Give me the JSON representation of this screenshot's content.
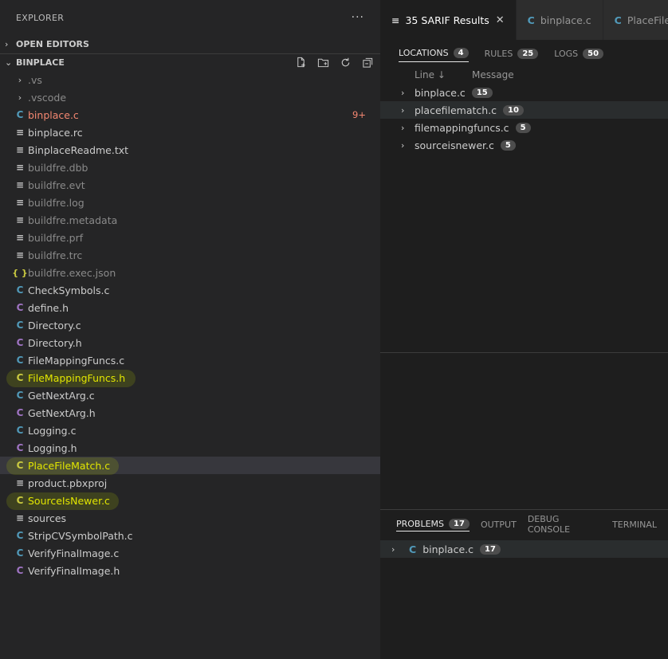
{
  "explorer": {
    "title": "EXPLORER",
    "more": "···",
    "open_editors": "OPEN EDITORS",
    "project": "BINPLACE",
    "files": [
      {
        "name": ".vs",
        "kind": "folder",
        "style": "dim"
      },
      {
        "name": ".vscode",
        "kind": "folder",
        "style": "dim"
      },
      {
        "name": "binplace.c",
        "kind": "c",
        "style": "err",
        "badge": "9+"
      },
      {
        "name": "binplace.rc",
        "kind": "lines",
        "style": ""
      },
      {
        "name": "BinplaceReadme.txt",
        "kind": "lines",
        "style": ""
      },
      {
        "name": "buildfre.dbb",
        "kind": "lines",
        "style": "dim"
      },
      {
        "name": "buildfre.evt",
        "kind": "lines",
        "style": "dim"
      },
      {
        "name": "buildfre.log",
        "kind": "lines",
        "style": "dim"
      },
      {
        "name": "buildfre.metadata",
        "kind": "lines",
        "style": "dim"
      },
      {
        "name": "buildfre.prf",
        "kind": "lines",
        "style": "dim"
      },
      {
        "name": "buildfre.trc",
        "kind": "lines",
        "style": "dim"
      },
      {
        "name": "buildfre.exec.json",
        "kind": "json",
        "style": "dim"
      },
      {
        "name": "CheckSymbols.c",
        "kind": "c",
        "style": ""
      },
      {
        "name": "define.h",
        "kind": "h",
        "style": ""
      },
      {
        "name": "Directory.c",
        "kind": "c",
        "style": ""
      },
      {
        "name": "Directory.h",
        "kind": "h",
        "style": ""
      },
      {
        "name": "FileMappingFuncs.c",
        "kind": "c",
        "style": ""
      },
      {
        "name": "FileMappingFuncs.h",
        "kind": "ch",
        "style": "hl"
      },
      {
        "name": "GetNextArg.c",
        "kind": "c",
        "style": ""
      },
      {
        "name": "GetNextArg.h",
        "kind": "h",
        "style": ""
      },
      {
        "name": "Logging.c",
        "kind": "c",
        "style": ""
      },
      {
        "name": "Logging.h",
        "kind": "h",
        "style": ""
      },
      {
        "name": "PlaceFileMatch.c",
        "kind": "ch",
        "style": "hl selected"
      },
      {
        "name": "product.pbxproj",
        "kind": "lines",
        "style": ""
      },
      {
        "name": "SourceIsNewer.c",
        "kind": "ch",
        "style": "hl"
      },
      {
        "name": "sources",
        "kind": "lines",
        "style": ""
      },
      {
        "name": "StripCVSymbolPath.c",
        "kind": "c",
        "style": ""
      },
      {
        "name": "VerifyFinalImage.c",
        "kind": "c",
        "style": ""
      },
      {
        "name": "VerifyFinalImage.h",
        "kind": "h",
        "style": ""
      }
    ]
  },
  "icons": {
    "c": "C",
    "h": "C",
    "ch": "C",
    "folder": "›",
    "lines": "≡",
    "json": "{ }"
  },
  "tabs": [
    {
      "label": "35 SARIF Results",
      "icon": "≡",
      "active": true
    },
    {
      "label": "binplace.c",
      "icon": "C",
      "active": false
    },
    {
      "label": "PlaceFileM",
      "icon": "C",
      "active": false
    }
  ],
  "sarif": {
    "tabs": [
      {
        "label": "LOCATIONS",
        "count": "4",
        "active": true
      },
      {
        "label": "RULES",
        "count": "25",
        "active": false
      },
      {
        "label": "LOGS",
        "count": "50",
        "active": false
      }
    ],
    "col_line": "Line",
    "col_sort_arrow": "↓",
    "col_message": "Message",
    "locations": [
      {
        "name": "binplace.c",
        "count": "15"
      },
      {
        "name": "placefilematch.c",
        "count": "10"
      },
      {
        "name": "filemappingfuncs.c",
        "count": "5"
      },
      {
        "name": "sourceisnewer.c",
        "count": "5"
      }
    ]
  },
  "panel": {
    "tabs": [
      {
        "label": "PROBLEMS",
        "count": "17",
        "active": true
      },
      {
        "label": "OUTPUT",
        "count": "",
        "active": false
      },
      {
        "label": "DEBUG CONSOLE",
        "count": "",
        "active": false
      },
      {
        "label": "TERMINAL",
        "count": "",
        "active": false
      }
    ],
    "problem_file": "binplace.c",
    "problem_count": "17"
  },
  "colors": {
    "c_icon": "#519aba",
    "h_icon": "#a074c4",
    "highlight_text": "#e2e600",
    "error_text": "#f48771"
  }
}
